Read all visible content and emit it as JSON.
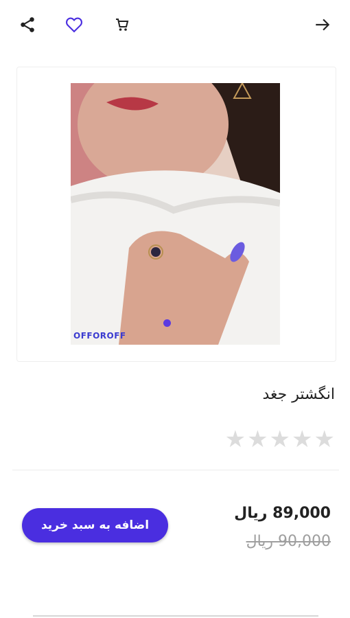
{
  "topbar": {
    "icons": [
      "share-icon",
      "heart-icon",
      "cart-icon",
      "arrow-forward-icon"
    ]
  },
  "product": {
    "image_logo_text": "OFFOROFF",
    "title": "انگشتر جغد",
    "rating": 0,
    "rating_max": 5,
    "price_current": "89,000 ریال",
    "price_old": "90,000 ریال",
    "add_to_cart_label": "اضافه به سبد خرید"
  },
  "colors": {
    "accent": "#4a2ee0",
    "carousel_dot": "#5b3be0",
    "star_empty": "#dcdcdc"
  }
}
